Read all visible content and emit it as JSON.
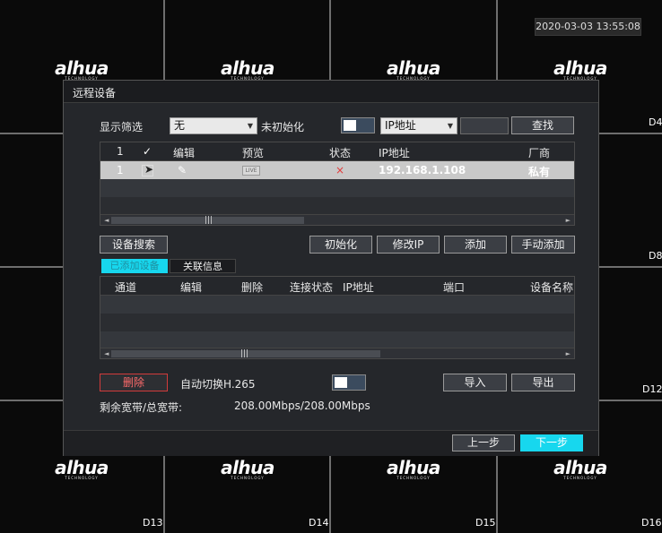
{
  "background": {
    "datetime": "2020-03-03 13:55:08",
    "logo_text": "alhua",
    "logo_sub": "TECHNOLOGY",
    "channel_labels": [
      "D4",
      "D8",
      "D12",
      "D13",
      "D14",
      "D15",
      "D16"
    ]
  },
  "dialog": {
    "title": "远程设备",
    "filter": {
      "label": "显示筛选",
      "value": "无",
      "uninit_label": "未初始化",
      "search_type": "IP地址",
      "search_input": "",
      "search_button": "查找"
    },
    "device_table": {
      "headers": [
        "1",
        "编辑",
        "预览",
        "状态",
        "IP地址",
        "厂商"
      ],
      "rows": [
        {
          "index": "1",
          "live": "LIVE",
          "status": "×",
          "ip": "192.168.1.108",
          "vendor": "私有"
        }
      ]
    },
    "buttons": {
      "device_search": "设备搜索",
      "initialize": "初始化",
      "modify_ip": "修改IP",
      "add": "添加",
      "manual_add": "手动添加"
    },
    "tabs": {
      "added_devices": "已添加设备",
      "related_info": "关联信息"
    },
    "added_table": {
      "headers": [
        "通道",
        "编辑",
        "删除",
        "连接状态",
        "IP地址",
        "端口",
        "设备名称"
      ]
    },
    "delete_button": "删除",
    "auto_h265_label": "自动切换H.265",
    "import_button": "导入",
    "export_button": "导出",
    "bandwidth_label": "剩余宽带/总宽带:",
    "bandwidth_value": "208.00Mbps/208.00Mbps",
    "prev_button": "上一步",
    "next_button": "下一步"
  },
  "colors": {
    "accent": "#17d7ee",
    "danger": "#d23b3b",
    "dialog_bg": "#25272b"
  }
}
